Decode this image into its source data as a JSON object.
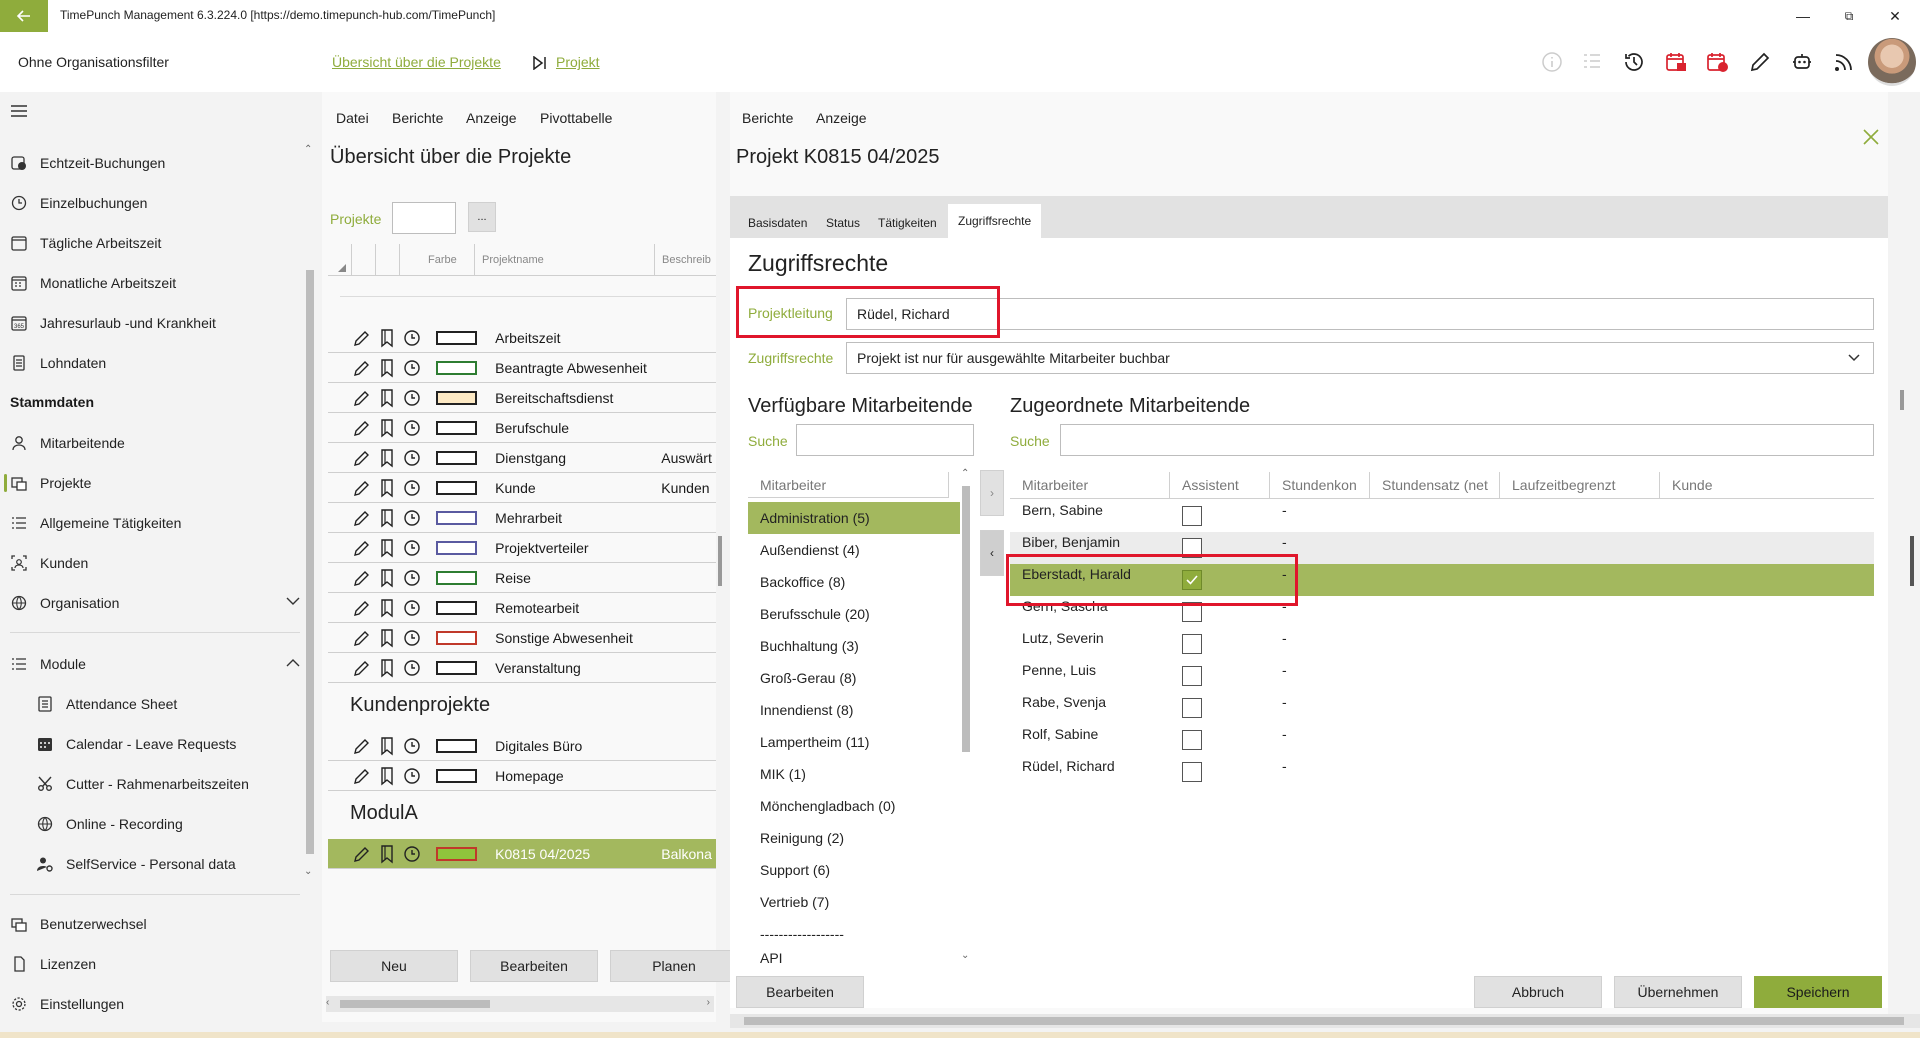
{
  "window": {
    "title": "TimePunch Management 6.3.224.0 [https://demo.timepunch-hub.com/TimePunch]",
    "minimize": "—",
    "maximize": "⧉",
    "close": "✕"
  },
  "header": {
    "org_filter": "Ohne Organisationsfilter",
    "breadcrumb_overview": "Übersicht über die Projekte",
    "breadcrumb_project": "Projekt"
  },
  "sidebar": {
    "items": [
      {
        "label": "Echtzeit-Buchungen",
        "icon": "realtime-icon"
      },
      {
        "label": "Einzelbuchungen",
        "icon": "clock-icon"
      },
      {
        "label": "Tägliche Arbeitszeit",
        "icon": "calendar-day-icon"
      },
      {
        "label": "Monatliche Arbeitszeit",
        "icon": "calendar-month-icon"
      },
      {
        "label": "Jahresurlaub -und Krankheit",
        "icon": "calendar-year-icon"
      },
      {
        "label": "Lohndaten",
        "icon": "payroll-icon"
      }
    ],
    "stammdaten_heading": "Stammdaten",
    "stammdaten": [
      {
        "label": "Mitarbeitende",
        "icon": "person-icon"
      },
      {
        "label": "Projekte",
        "icon": "projects-icon"
      },
      {
        "label": "Allgemeine Tätigkeiten",
        "icon": "list-icon"
      },
      {
        "label": "Kunden",
        "icon": "customer-icon"
      },
      {
        "label": "Organisation",
        "icon": "globe-icon"
      }
    ],
    "module_heading": "Module",
    "modules": [
      {
        "label": "Attendance Sheet",
        "icon": "sheet-icon"
      },
      {
        "label": "Calendar - Leave Requests",
        "icon": "calendar-icon"
      },
      {
        "label": "Cutter - Rahmenarbeitszeiten",
        "icon": "scissors-icon"
      },
      {
        "label": "Online - Recording",
        "icon": "globe-icon"
      },
      {
        "label": "SelfService - Personal data",
        "icon": "person-gear-icon"
      }
    ],
    "bottom": [
      {
        "label": "Benutzerwechsel",
        "icon": "switch-user-icon"
      },
      {
        "label": "Lizenzen",
        "icon": "license-icon"
      },
      {
        "label": "Einstellungen",
        "icon": "gear-icon"
      }
    ]
  },
  "middle": {
    "menu": [
      "Datei",
      "Berichte",
      "Anzeige",
      "Pivottabelle"
    ],
    "title": "Übersicht über die Projekte",
    "filter_label": "Projekte",
    "filter_value": "",
    "filter_button": "...",
    "columns": {
      "farbe": "Farbe",
      "projektname": "Projektname",
      "beschreibung": "Beschreib"
    },
    "projects": [
      {
        "name": "Arbeitszeit",
        "desc": "",
        "color": "#ffffff",
        "border": "#222222"
      },
      {
        "name": "Beantragte Abwesenheit",
        "desc": "",
        "color": "#ffffff",
        "border": "#2e7d32"
      },
      {
        "name": "Bereitschaftsdienst",
        "desc": "",
        "color": "#fde9c4",
        "border": "#222222"
      },
      {
        "name": "Berufschule",
        "desc": "",
        "color": "#ffffff",
        "border": "#222222"
      },
      {
        "name": "Dienstgang",
        "desc": "Auswärt",
        "color": "#ffffff",
        "border": "#222222"
      },
      {
        "name": "Kunde",
        "desc": "Kunden",
        "color": "#ffffff",
        "border": "#222222"
      },
      {
        "name": "Mehrarbeit",
        "desc": "",
        "color": "#ffffff",
        "border": "#5a5aa0"
      },
      {
        "name": "Projektverteiler",
        "desc": "",
        "color": "#ffffff",
        "border": "#5a5aa0"
      },
      {
        "name": "Reise",
        "desc": "",
        "color": "#ffffff",
        "border": "#2e7d32"
      },
      {
        "name": "Remotearbeit",
        "desc": "",
        "color": "#ffffff",
        "border": "#222222"
      },
      {
        "name": "Sonstige Abwesenheit",
        "desc": "",
        "color": "#ffffff",
        "border": "#c0392b"
      },
      {
        "name": "Veranstaltung",
        "desc": "",
        "color": "#ffffff",
        "border": "#222222"
      }
    ],
    "group_kunden": "Kundenprojekte",
    "kunden_projects": [
      {
        "name": "Digitales Büro",
        "desc": "",
        "color": "#ffffff",
        "border": "#222222"
      },
      {
        "name": "Homepage",
        "desc": "",
        "color": "#ffffff",
        "border": "#222222"
      }
    ],
    "group_modula": "ModulA",
    "modula_projects": [
      {
        "name": "K0815 04/2025",
        "desc": "Balkona",
        "color": "#8fc43c",
        "border": "#c0392b"
      }
    ],
    "buttons": {
      "neu": "Neu",
      "bearbeiten": "Bearbeiten",
      "planen": "Planen"
    }
  },
  "right": {
    "menu": [
      "Berichte",
      "Anzeige"
    ],
    "title": "Projekt K0815 04/2025",
    "tabs": [
      "Basisdaten",
      "Status",
      "Tätigkeiten",
      "Zugriffsrechte"
    ],
    "active_tab": "Zugriffsrechte",
    "section_title": "Zugriffsrechte",
    "projektleitung_label": "Projektleitung",
    "projektleitung_value": "Rüdel, Richard",
    "zugriffsrechte_label": "Zugriffsrechte",
    "zugriffsrechte_value": "Projekt ist nur für ausgewählte Mitarbeiter buchbar",
    "available_title": "Verfügbare Mitarbeitende",
    "assigned_title": "Zugeordnete Mitarbeitende",
    "search_label": "Suche",
    "search_value": "",
    "available_col": "Mitarbeiter",
    "groups": [
      "Administration (5)",
      "Außendienst (4)",
      "Backoffice (8)",
      "Berufsschule (20)",
      "Buchhaltung (3)",
      "Groß-Gerau (8)",
      "Innendienst (8)",
      "Lampertheim (11)",
      "MIK (1)",
      "Mönchengladbach (0)",
      "Reinigung (2)",
      "Support (6)",
      "Vertrieb (7)",
      "------------------",
      "API"
    ],
    "selected_group": "Administration (5)",
    "assigned_columns": [
      "Mitarbeiter",
      "Assistent",
      "Stundenkon",
      "Stundensatz (net",
      "Laufzeitbegrenzt",
      "Kunde"
    ],
    "employees": [
      {
        "name": "Bern, Sabine",
        "assistent": false,
        "stunden": "-"
      },
      {
        "name": "Biber, Benjamin",
        "assistent": false,
        "stunden": "-"
      },
      {
        "name": "Eberstadt, Harald",
        "assistent": true,
        "stunden": "-"
      },
      {
        "name": "Gern, Sascha",
        "assistent": false,
        "stunden": "-"
      },
      {
        "name": "Lutz, Severin",
        "assistent": false,
        "stunden": "-"
      },
      {
        "name": "Penne, Luis",
        "assistent": false,
        "stunden": "-"
      },
      {
        "name": "Rabe, Svenja",
        "assistent": false,
        "stunden": "-"
      },
      {
        "name": "Rolf, Sabine",
        "assistent": false,
        "stunden": "-"
      },
      {
        "name": "Rüdel, Richard",
        "assistent": false,
        "stunden": "-"
      }
    ],
    "buttons": {
      "bearbeiten": "Bearbeiten",
      "abbruch": "Abbruch",
      "uebernehmen": "Übernehmen",
      "speichern": "Speichern"
    },
    "accent": "#8fac3c",
    "highlight": "#e0162b"
  }
}
